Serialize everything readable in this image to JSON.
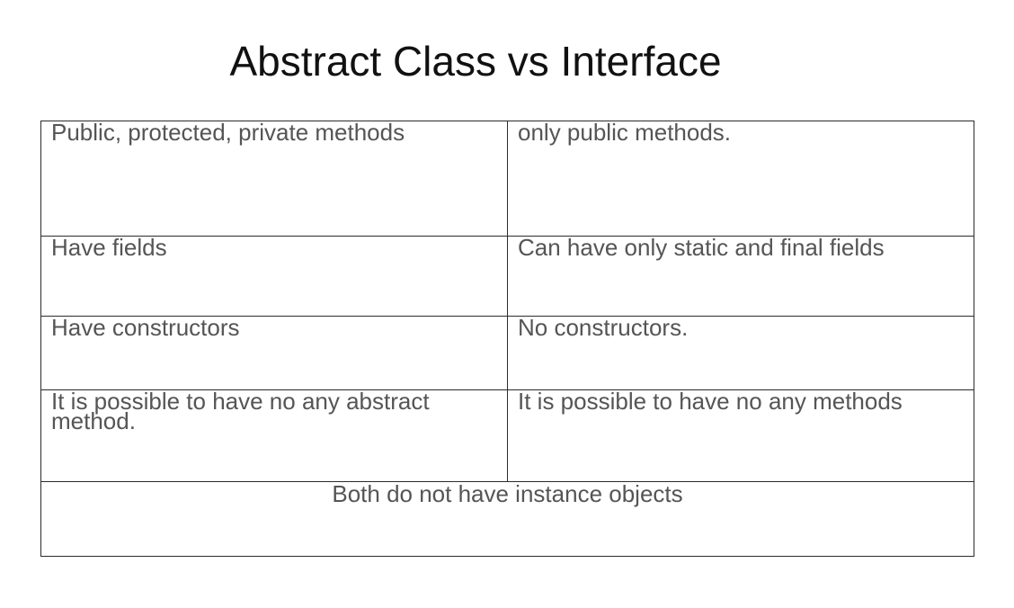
{
  "title": "Abstract Class vs Interface",
  "table": {
    "rows": [
      {
        "left": "Public, protected, private methods",
        "right": "only public methods."
      },
      {
        "left": "Have fields",
        "right": "Can have only static and final fields"
      },
      {
        "left": "Have constructors",
        "right": "No constructors."
      },
      {
        "left": "It is possible to have no any abstract method.",
        "right": "It is possible to have no any methods"
      }
    ],
    "footer": "Both do not have instance objects"
  }
}
